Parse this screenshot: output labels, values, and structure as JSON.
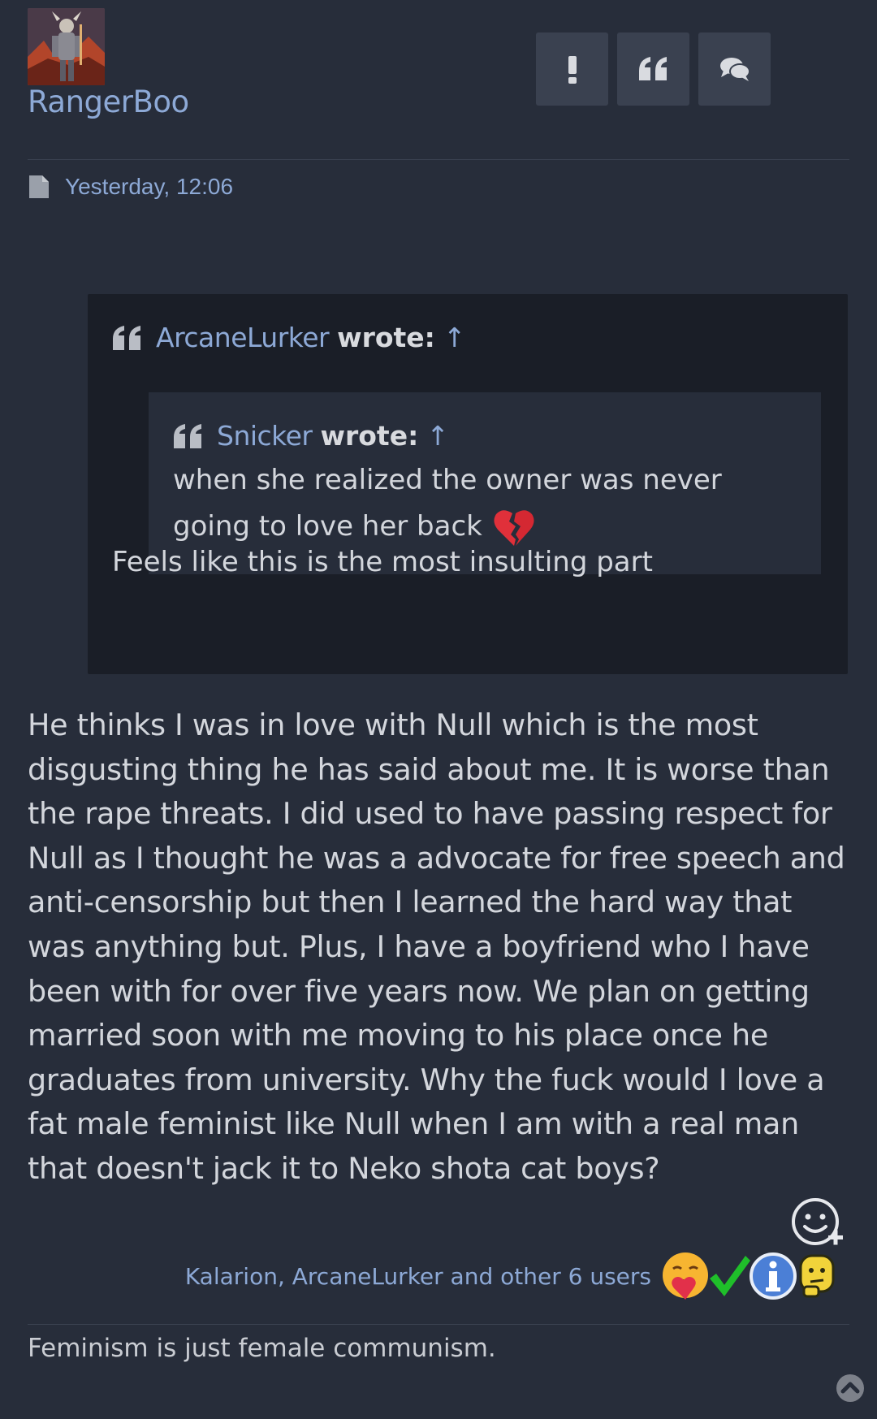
{
  "post": {
    "username": "RangerBoo",
    "date": "Yesterday, 12:06",
    "actions": [
      {
        "name": "report",
        "icon": "exclamation-icon"
      },
      {
        "name": "quote",
        "icon": "quote-icon"
      },
      {
        "name": "reply",
        "icon": "comments-icon"
      }
    ],
    "quote": {
      "author": "ArcaneLurker",
      "wrote_label": "wrote:",
      "jump_arrow": "↑",
      "nested": {
        "author": "Snicker",
        "wrote_label": "wrote:",
        "jump_arrow": "↑",
        "line1": "when she realized the owner was never",
        "line2": "going to love her back",
        "emoji": "broken-heart-icon"
      },
      "text": "Feels like this is the most insulting part"
    },
    "body_lines": [
      "He thinks I was in love with Null which is the most",
      "disgusting thing he has said about me. It is worse than",
      "the rape threats. I did used to have passing respect for",
      "Null as I thought he was a advocate for free speech and",
      "anti-censorship but then I learned the hard way that",
      "was anything but. Plus, I have a boyfriend who I have",
      "been with for over five years now. We plan on getting",
      "married soon with me moving to his place once he",
      "graduates from university. Why the fuck would I love a",
      "fat male feminist like Null when I am with a real man",
      "that doesn't jack it to Neko shota cat boys?"
    ],
    "reactions": {
      "users_text": "Kalarion, ArcaneLurker and other 6 users",
      "icons": [
        "hugging-heart-icon",
        "check-mark-icon",
        "info-icon",
        "thinking-icon"
      ]
    },
    "signature": "Feminism is just female communism."
  },
  "colors": {
    "background": "#272d3a",
    "quote_background": "#1a1e27",
    "link": "#8da9d6",
    "text": "#d3d6dc",
    "button": "#3a4150"
  }
}
